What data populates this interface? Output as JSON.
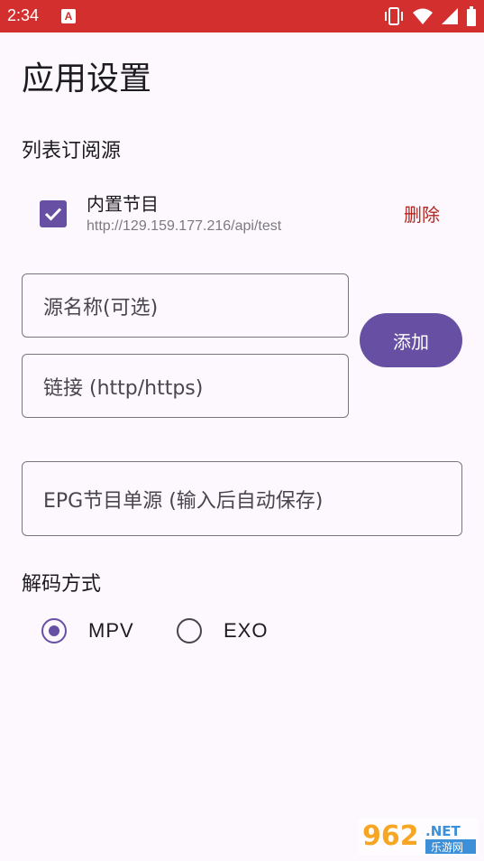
{
  "status_bar": {
    "time": "2:34",
    "notification_icon_letter": "A",
    "icons": [
      "vibrate-icon",
      "wifi-icon",
      "signal-icon",
      "battery-icon"
    ]
  },
  "page": {
    "title": "应用设置"
  },
  "subscription": {
    "section_title": "列表订阅源",
    "items": [
      {
        "name": "内置节目",
        "url": "http://129.159.177.216/api/test",
        "checked": true,
        "delete_label": "删除"
      }
    ]
  },
  "form": {
    "source_name_placeholder": "源名称(可选)",
    "link_placeholder": "链接 (http/https)",
    "add_label": "添加",
    "epg_placeholder": "EPG节目单源 (输入后自动保存)"
  },
  "decoder": {
    "section_title": "解码方式",
    "options": [
      {
        "label": "MPV",
        "selected": true
      },
      {
        "label": "EXO",
        "selected": false
      }
    ]
  },
  "watermark": {
    "number": "962",
    "suffix": ".NET",
    "site": "乐游网"
  },
  "colors": {
    "status_bar": "#d32f2f",
    "primary": "#6750a4",
    "delete": "#b3261e",
    "background": "#fdf8fd"
  }
}
